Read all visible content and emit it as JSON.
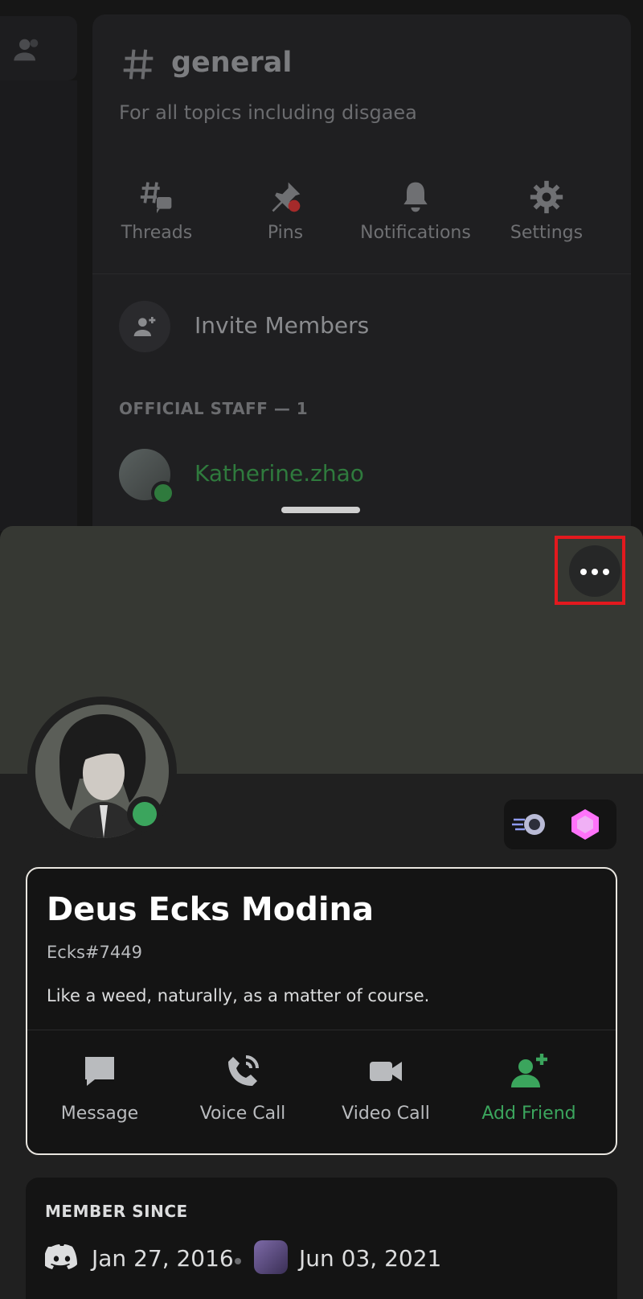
{
  "channel": {
    "name": "general",
    "topic": "For all topics including disgaea",
    "toolbar": [
      {
        "label": "Threads",
        "icon": "threads-icon"
      },
      {
        "label": "Pins",
        "icon": "pin-icon"
      },
      {
        "label": "Notifications",
        "icon": "bell-icon"
      },
      {
        "label": "Settings",
        "icon": "gear-icon"
      }
    ],
    "invite_label": "Invite Members",
    "section_header": "OFFICIAL STAFF — 1",
    "staff_member": "Katherine.zhao"
  },
  "profile": {
    "display_name": "Deus Ecks Modina",
    "tag": "Ecks#7449",
    "bio": "Like a weed, naturally, as a matter of course.",
    "actions": [
      {
        "label": "Message",
        "icon": "message-icon"
      },
      {
        "label": "Voice Call",
        "icon": "voice-call-icon"
      },
      {
        "label": "Video Call",
        "icon": "video-call-icon"
      },
      {
        "label": "Add Friend",
        "icon": "add-friend-icon"
      }
    ],
    "member_since": {
      "header": "MEMBER SINCE",
      "discord_date": "Jan 27, 2016",
      "server_date": "Jun 03, 2021"
    }
  },
  "colors": {
    "online": "#3ba55d",
    "highlight": "#e3191e",
    "staff_name": "#2f7a3d"
  }
}
